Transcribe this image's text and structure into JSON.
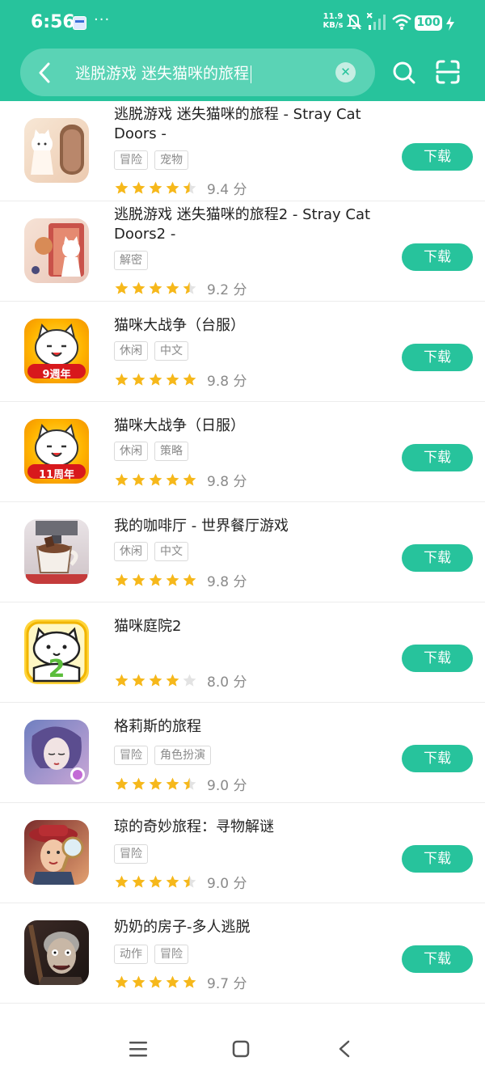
{
  "status_bar": {
    "time": "6:56",
    "net_speed_value": "11.9",
    "net_speed_unit": "KB/s",
    "battery": "100"
  },
  "search": {
    "query": "逃脱游戏 迷失猫咪的旅程"
  },
  "apps": [
    {
      "title": "逃脱游戏 迷失猫咪的旅程 - Stray Cat Doors -",
      "tags": [
        "冒险",
        "宠物"
      ],
      "rating": 4.5,
      "score": "9.4 分",
      "button": "下载"
    },
    {
      "title": "逃脱游戏 迷失猫咪的旅程2 - Stray Cat Doors2 -",
      "tags": [
        "解密"
      ],
      "rating": 4.5,
      "score": "9.2 分",
      "button": "下载"
    },
    {
      "title": "猫咪大战争（台服）",
      "tags": [
        "休闲",
        "中文"
      ],
      "rating": 5,
      "score": "9.8 分",
      "button": "下载",
      "icon_text": "9週年"
    },
    {
      "title": "猫咪大战争（日服）",
      "tags": [
        "休闲",
        "策略"
      ],
      "rating": 5,
      "score": "9.8 分",
      "button": "下载",
      "icon_text": "11周年"
    },
    {
      "title": "我的咖啡厅 - 世界餐厅游戏",
      "tags": [
        "休闲",
        "中文"
      ],
      "rating": 5,
      "score": "9.8 分",
      "button": "下载"
    },
    {
      "title": "猫咪庭院2",
      "tags": [],
      "rating": 4,
      "score": "8.0 分",
      "button": "下载",
      "icon_text": "2"
    },
    {
      "title": "格莉斯的旅程",
      "tags": [
        "冒险",
        "角色扮演"
      ],
      "rating": 4.5,
      "score": "9.0 分",
      "button": "下载"
    },
    {
      "title": "琼的奇妙旅程：寻物解谜",
      "tags": [
        "冒险"
      ],
      "rating": 4.5,
      "score": "9.0 分",
      "button": "下载"
    },
    {
      "title": "奶奶的房子-多人逃脱",
      "tags": [
        "动作",
        "冒险"
      ],
      "rating": 5,
      "score": "9.7 分",
      "button": "下载"
    }
  ],
  "colors": {
    "accent": "#27c39c",
    "star": "#f6b81b",
    "star_empty": "#e3e3e3"
  }
}
